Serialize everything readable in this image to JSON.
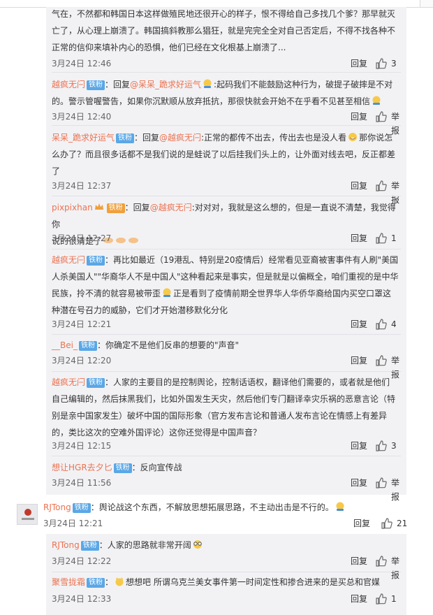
{
  "colors": {
    "username": "#eb7350",
    "badge": "#5aa7e6",
    "badge_gold": "#f0a03c",
    "panel_bg": "#f2f2f5"
  },
  "labels": {
    "reply": "回复",
    "report": "举报"
  },
  "comments": [
    {
      "lines": [
        "气在，不然都和韩国日本这样做殖民地还很开心的样子，恨不得给自己多找几个爹？那早就灭",
        "亡了，从心理上崩溃了。韩国搞斜教那么猖狂，就是完完全全对自己否定后，不得不找各种不",
        "正常的信仰来填补内心的恐惧，他们已经在文化根基上崩溃了..."
      ],
      "time": "3月24日 12:46",
      "likes": "3"
    },
    {
      "user": "越疯无闩",
      "badge": "铁粉",
      "reply_prefix": "：回复",
      "target": "@呆呆_跪求好运气",
      "line1": ":起码我们不能鼓励这种行为，破提子破摔是不对",
      "line2": "的。警示管喔警告，如果你沉默顺从放弃抵抗，那很快就会开始不在乎看不见甚至相信",
      "time": "3月24日 12:40",
      "likes": ""
    },
    {
      "user": "呆呆_跪求好运气",
      "badge": "铁粉",
      "reply_prefix": "：回复",
      "target": "@越疯无闩",
      "line1": ":正常的都传不出去，传出去也是没人看",
      "line1b": "那你说怎",
      "line2": "么办了？而且很多话都不是我们说的是蛙说了以后挂我们头上的，让外面对线去吧，反正都差",
      "line3": "了",
      "time": "3月24日 12:37",
      "likes": ""
    },
    {
      "user": "pixpixhan",
      "badge": "铁粉",
      "reply_prefix": "：回复",
      "target": "@越疯无闩",
      "line1": ":对对对，我就是这么想的，但是一直说不清楚，我觉得你",
      "line2": "说的很清楚了",
      "time": "3月24日 12:27",
      "likes": "1"
    },
    {
      "user": "越疯无闩",
      "badge": "铁粉",
      "line1": "：再比如最近（19港乱、特别是20疫情后）经常看见亚裔被害事件有人刷\"美国",
      "line2": "人杀美国人\"\"华裔华人不是中国人\"这种看起来是事实，但是就是以偏概全，咱们重视的是中华",
      "line3": "民族，拎不清的就容易被带歪",
      "line3b": "正是看到了疫情前期全世界华人华侨华裔给国内买空口罩这",
      "line4": "种潜在号召力的威胁，它们才开始潜移默化分化",
      "time": "3月24日 12:21",
      "likes": "4"
    },
    {
      "user": "__Bei_",
      "badge": "铁粉",
      "line1": "：你确定不是他们反串的想要的\"声音\"",
      "time": "3月24日 12:20",
      "likes": ""
    },
    {
      "user": "越疯无闩",
      "badge": "铁粉",
      "line1": "：人家的主要目的是控制舆论，控制话语权，翻译他们需要的，或者就是他们",
      "line2": "自己编辑的，然后抹黑我们，比如外国发生天灾，然后他们专门翻译幸灾乐祸的恶意言论（特",
      "line3": "别是亲中国家发生）破坏中国的国际形象（官方发布言论和普通人发布言论在情感上有差异",
      "line4": "的，类比这次的空难外国评论）这你还觉得是中国声音？",
      "time": "3月24日 12:15",
      "likes": "3"
    },
    {
      "user": "想让HGR去夕匕",
      "badge": "铁粉",
      "line1": "：反向宣传战",
      "time": "3月24日 11:56",
      "likes": ""
    },
    {
      "user": "RJTong",
      "badge": "铁粉",
      "line1": "：舆论战这个东西，不解放思想拓展思路，不主动出击是不行的。",
      "time": "3月24日 12:21",
      "likes": "21"
    },
    {
      "user": "RJTong",
      "badge": "铁粉",
      "line1": "：人家的思路就非常开阔",
      "time": "3月24日 12:22",
      "likes": ""
    },
    {
      "user": "聚雪拢霜",
      "badge": "铁粉",
      "line1": "想想吧 所谓乌克兰美女事件第一时间定性和掺合进来的是买总和官媒",
      "time": "3月24日 12:33",
      "likes": "1"
    }
  ]
}
